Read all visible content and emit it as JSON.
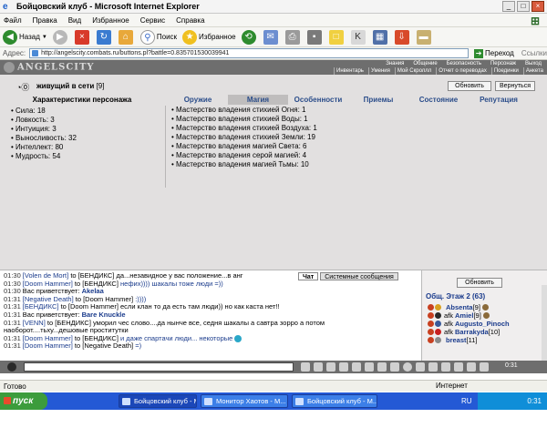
{
  "window": {
    "title": "Бойцовский клуб - Microsoft Internet Explorer"
  },
  "menu": [
    "Файл",
    "Правка",
    "Вид",
    "Избранное",
    "Сервис",
    "Справка"
  ],
  "toolbar": {
    "back": "Назад",
    "search": "Поиск",
    "favorites": "Избранное"
  },
  "address": {
    "label": "Адрес:",
    "url": "http://angelscity.combats.ru/buttons.pl?battle=0.835701530039941",
    "go": "Переход",
    "links": "Ссылки"
  },
  "game": {
    "logo": "ANGELSCITY",
    "topnav1": [
      "Знания",
      "Общение",
      "Безопасность",
      "Персонаж",
      "Выход"
    ],
    "topnav2": [
      "Инвентарь",
      "Умения",
      "Мой Скроллл",
      "Отчет о переводах",
      "Поединки",
      "Анкета"
    ],
    "status_text": "живущий в сети",
    "status_level": "[9]",
    "refresh_button": "Обновить",
    "back_button": "Вернуться",
    "char_header": "Характеристики персонажа",
    "stats": [
      "Сила: 18",
      "Ловкость: 3",
      "Интуиция: 3",
      "Выносливость: 32",
      "Интеллект: 80",
      "Мудрость: 54"
    ],
    "tabs": [
      "Оружие",
      "Магия",
      "Особенности",
      "Приемы",
      "Состояние",
      "Репутация"
    ],
    "active_tab": "Магия",
    "magic": [
      "Мастерство владения стихией Огня: 1",
      "Мастерство владения стихией Воды: 1",
      "Мастерство владения стихией Воздуха: 1",
      "Мастерство владения стихией Земли: 19",
      "Мастерство владения магией Света: 6",
      "Мастерство владения серой магией: 4",
      "Мастерство владения магией Тьмы: 10"
    ]
  },
  "chat": {
    "tabs": [
      "Чат",
      "Системные сообщения"
    ],
    "lines": [
      {
        "time": "01:30",
        "nick": "[Volen de Mort]",
        "to": "to [БЕНДИКС]",
        "msg": "да...незавидное у вас положение...в анг"
      },
      {
        "time": "01:30",
        "nick": "[Doom Hammer]",
        "to": "to [БЕНДИКС]",
        "msg": "нефих)))) шакалы тоже люди =))"
      },
      {
        "time": "01:30",
        "nick": "",
        "to": "Вас приветствует:",
        "msg": "Akelaa"
      },
      {
        "time": "01:31",
        "nick": "[Negative Death]",
        "to": "to [Doom Hammer]",
        "msg": ":))))"
      },
      {
        "time": "01:31",
        "nick": "[БЕНДИКС]",
        "to": "to [Doom Hammer]",
        "msg": "если клан то да есть там люди)) но как каста нет!!"
      },
      {
        "time": "01:31",
        "nick": "",
        "to": "Вас приветствует:",
        "msg": "Bare Knuckle"
      },
      {
        "time": "01:31",
        "nick": "[VENN]",
        "to": "to [БЕНДИКС]",
        "msg": "уморил чес слово....да нынче все, седня шакалы а савтра зорро а потом"
      },
      {
        "time": "",
        "nick": "",
        "to": "",
        "msg": "наоборот....тьху...дешовые проститутки"
      },
      {
        "time": "01:31",
        "nick": "[Doom Hammer]",
        "to": "to [БЕНДИКС]",
        "msg": "и даже спартачи люди... некоторые"
      },
      {
        "time": "01:31",
        "nick": "[Doom Hammer]",
        "to": "to [Negative Death]",
        "msg": "=)"
      }
    ],
    "refresh": "Обновить",
    "room_title": "Общ. Этаж 2 (63)",
    "users": [
      {
        "afk": "",
        "name": "Absenta",
        "level": "[9]"
      },
      {
        "afk": "afk",
        "name": "Amiel",
        "level": "[9]"
      },
      {
        "afk": "afk",
        "name": "Augusto_Pinoch",
        "level": ""
      },
      {
        "afk": "afk",
        "name": "Barrakyda",
        "level": "[10]"
      },
      {
        "afk": "",
        "name": "breast",
        "level": "[11]"
      }
    ],
    "clock": "0:31"
  },
  "statusbar": {
    "left": "Готово",
    "zone": "Интернет"
  },
  "taskbar": {
    "start": "пуск",
    "tasks": [
      "Бойцовский клуб - М...",
      "Монитор Хаотов - М...",
      "Бойцовский клуб - М..."
    ],
    "lang": "RU",
    "time": "0:31"
  },
  "colors": {
    "tab_active": "#bfbdbd",
    "nick_blue": "#1a3b8c",
    "taskbar": "#2459d5"
  }
}
